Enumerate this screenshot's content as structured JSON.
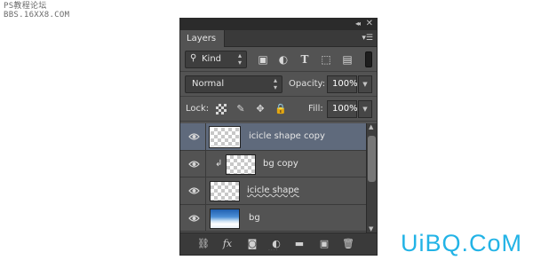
{
  "watermark_top": {
    "line1": "PS教程论坛",
    "line2": "BBS.16XX8.COM"
  },
  "watermark_bottom": {
    "part1": "UiBQ",
    "part2": ".CoM"
  },
  "panel": {
    "collapse_icon": "double-chevron-icon",
    "close_label": "✕",
    "tab_label": "Layers",
    "menu_icon": "panel-menu-icon",
    "filter": {
      "label": "Kind",
      "icons": [
        "image-filter-icon",
        "adjustment-filter-icon",
        "type-filter-icon",
        "shape-filter-icon",
        "smart-object-filter-icon"
      ]
    },
    "blend_mode": "Normal",
    "opacity_label": "Opacity:",
    "opacity_value": "100%",
    "lock_label": "Lock:",
    "lock_icons": [
      "lock-transparent-icon",
      "lock-image-icon",
      "lock-position-icon",
      "lock-all-icon"
    ],
    "fill_label": "Fill:",
    "fill_value": "100%",
    "layers": [
      {
        "name": "icicle shape copy",
        "selected": true,
        "clipped": false,
        "thumb": "transparent"
      },
      {
        "name": "bg copy",
        "selected": false,
        "clipped": true,
        "thumb": "transparent"
      },
      {
        "name": "icicle shape",
        "selected": false,
        "clipped": false,
        "thumb": "transparent",
        "warped_text": true
      },
      {
        "name": "bg",
        "selected": false,
        "clipped": false,
        "thumb": "sky"
      }
    ],
    "footer_icons": [
      "link-layers-icon",
      "fx-icon",
      "add-mask-icon",
      "new-adjustment-icon",
      "new-group-icon",
      "new-layer-icon",
      "delete-icon"
    ],
    "footer_fx_label": "fx"
  },
  "colors": {
    "panel_bg": "#535353",
    "selected_row": "#5f6a7c",
    "watermark_blue": "#22b3e6"
  }
}
